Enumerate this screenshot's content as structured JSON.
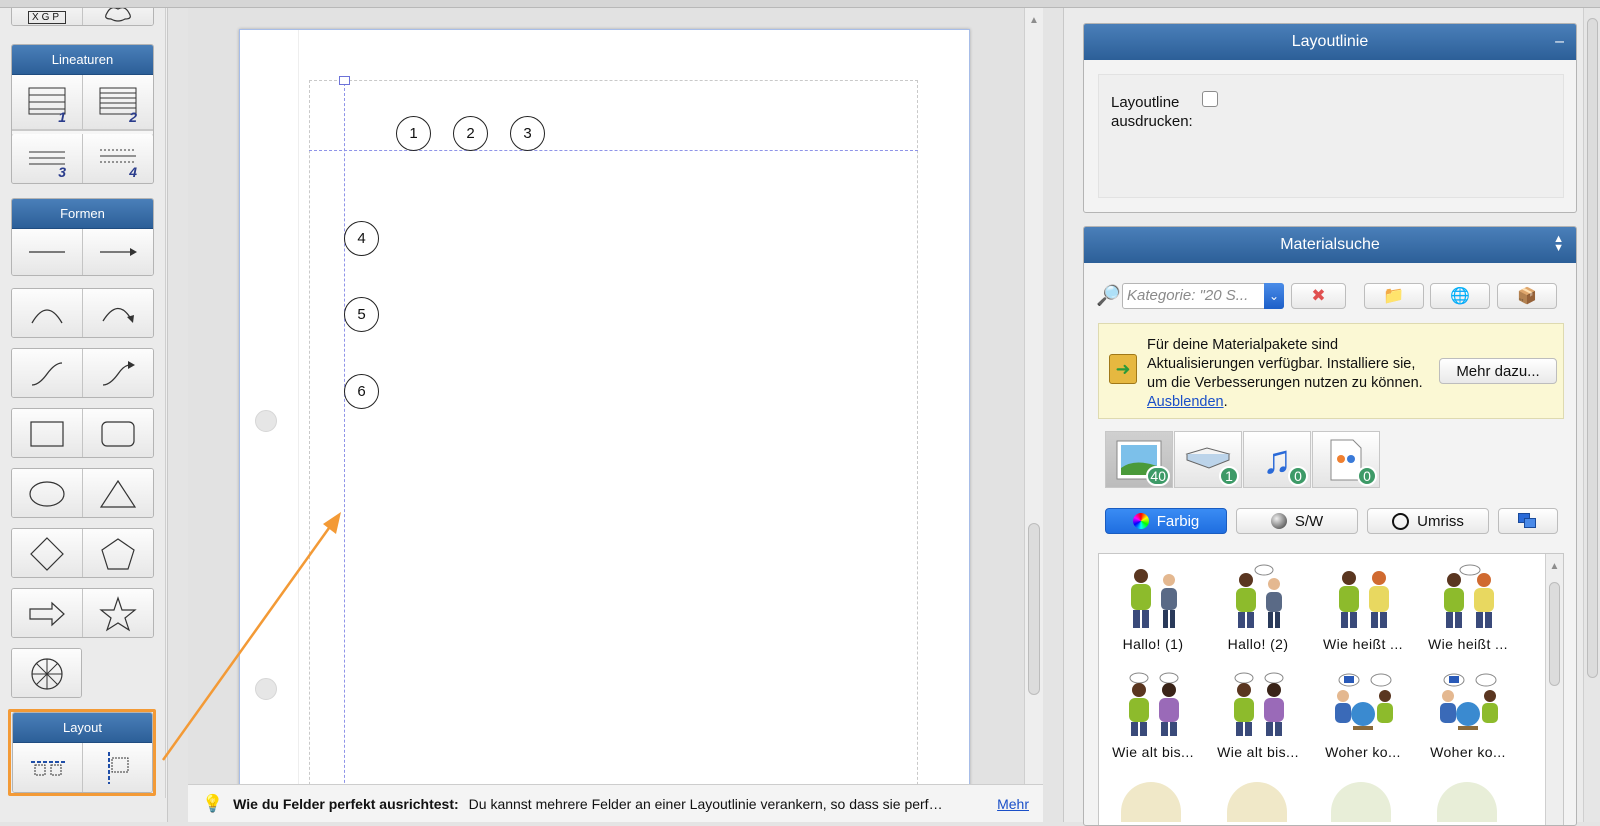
{
  "left_panel": {
    "groups": [
      {
        "title": "Lineaturen",
        "numbers": [
          "1",
          "2",
          "3",
          "4"
        ]
      },
      {
        "title": "Formen"
      },
      {
        "title": "Layout"
      }
    ]
  },
  "top_partial": {
    "icon_text": "XGP"
  },
  "page": {
    "markers": [
      "1",
      "2",
      "3",
      "4",
      "5",
      "6"
    ]
  },
  "tip": {
    "bold": "Wie du Felder perfekt ausrichtest:",
    "text": "Du kannst mehrere Felder an einer Layoutlinie verankern, so dass sie perf…",
    "more": "Mehr"
  },
  "layoutlinie": {
    "title": "Layoutlinie",
    "collapse": "–",
    "print_label_line1": "Layoutline",
    "print_label_line2": "ausdrucken:"
  },
  "materialsuche": {
    "title": "Materialsuche",
    "search_placeholder": "Kategorie: \"20 S...",
    "notice": {
      "text": "Für deine Materialpakete sind Aktualisierungen verfügbar. Installiere sie, um die Verbesserungen nutzen zu können.",
      "link": "Ausblenden",
      "link_suffix": ".",
      "button": "Mehr dazu..."
    },
    "type_tabs": [
      {
        "icon": "image-icon",
        "count": "40"
      },
      {
        "icon": "book-icon",
        "count": "1"
      },
      {
        "icon": "music-note-icon",
        "count": "0"
      },
      {
        "icon": "document-icon",
        "count": "0"
      }
    ],
    "color_filters": [
      "Farbig",
      "S/W",
      "Umriss"
    ],
    "results": [
      "Hallo! (1)",
      "Hallo! (2)",
      "Wie heißt ...",
      "Wie heißt ...",
      "Wie alt bis...",
      "Wie alt bis...",
      "Woher ko...",
      "Woher ko..."
    ]
  },
  "colors": {
    "header_blue": "#2c5f98",
    "accent_orange": "#f39a36",
    "selected_blue": "#1f74e8",
    "badge_green": "#3d9a67",
    "notice_yellow": "#fbf8d4"
  }
}
